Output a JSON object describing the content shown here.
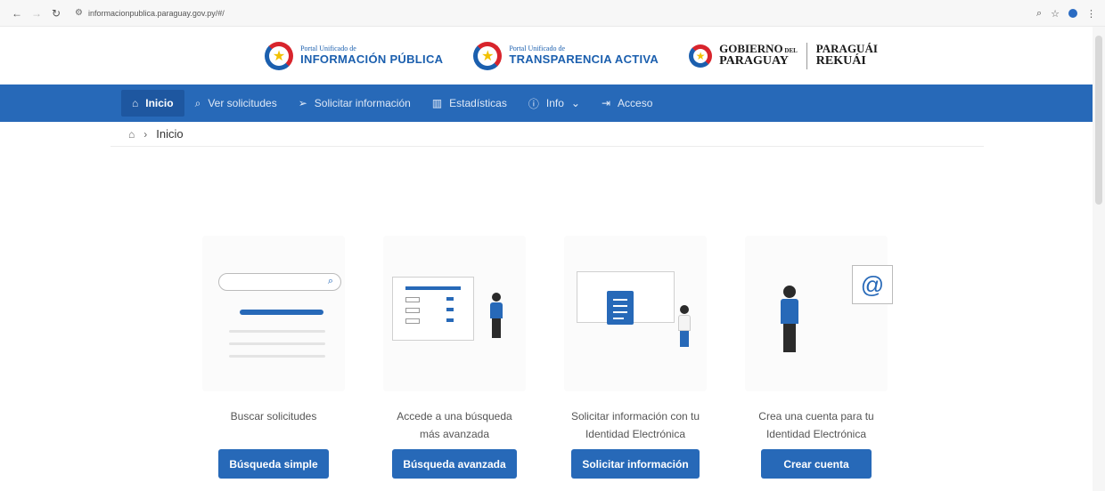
{
  "browser": {
    "url": "informacionpublica.paraguay.gov.py/#/",
    "back_icon": "arrow-left-icon",
    "forward_icon": "arrow-right-icon",
    "reload_icon": "reload-icon"
  },
  "logos": {
    "informacion": {
      "small": "Portal Unificado de",
      "big": "INFORMACIÓN PÚBLICA"
    },
    "transparencia": {
      "small": "Portal Unificado de",
      "big": "TRANSPARENCIA ACTIVA"
    },
    "gobierno": {
      "l1": "GOBIERNO",
      "l1_small": "DEL",
      "l2": "PARAGUAY",
      "r1": "PARAGUÁI",
      "r2": "REKUÁI"
    }
  },
  "navbar": {
    "items": [
      {
        "label": "Inicio",
        "icon": "home-icon"
      },
      {
        "label": "Ver solicitudes",
        "icon": "search-icon"
      },
      {
        "label": "Solicitar información",
        "icon": "send-icon"
      },
      {
        "label": "Estadísticas",
        "icon": "chart-icon"
      },
      {
        "label": "Info",
        "icon": "help-icon"
      },
      {
        "label": "Acceso",
        "icon": "login-icon"
      }
    ]
  },
  "breadcrumb": {
    "current": "Inicio"
  },
  "cards": [
    {
      "line1": "Buscar solicitudes",
      "line2": "",
      "button": "Búsqueda simple"
    },
    {
      "line1": "Accede a una búsqueda",
      "line2": "más avanzada",
      "button": "Búsqueda avanzada"
    },
    {
      "line1": "Solicitar información con tu",
      "line2": "Identidad Electrónica",
      "button": "Solicitar información"
    },
    {
      "line1": "Crea una cuenta para tu",
      "line2": "Identidad Electrónica",
      "button": "Crear cuenta"
    }
  ],
  "colors": {
    "primary": "#2769b8",
    "active_nav": "#1e57a0"
  }
}
